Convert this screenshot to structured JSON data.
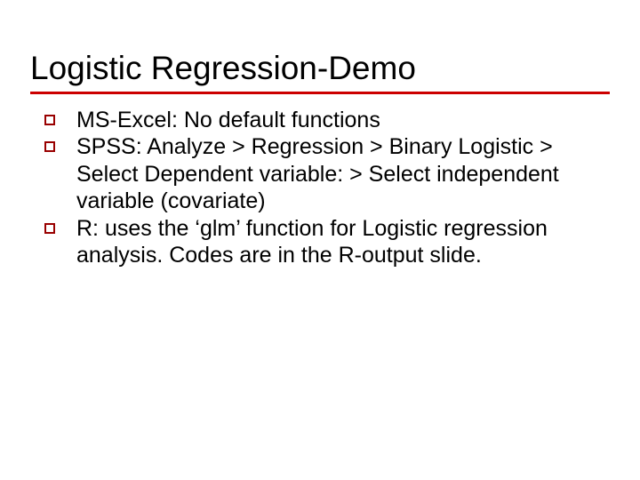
{
  "slide": {
    "title": "Logistic Regression-Demo",
    "bullets": [
      "MS-Excel: No default functions",
      "SPSS: Analyze > Regression > Binary Logistic > Select Dependent variable: > Select independent variable (covariate)",
      "R: uses the ‘glm’ function for Logistic regression analysis. Codes are in the R-output slide."
    ]
  }
}
